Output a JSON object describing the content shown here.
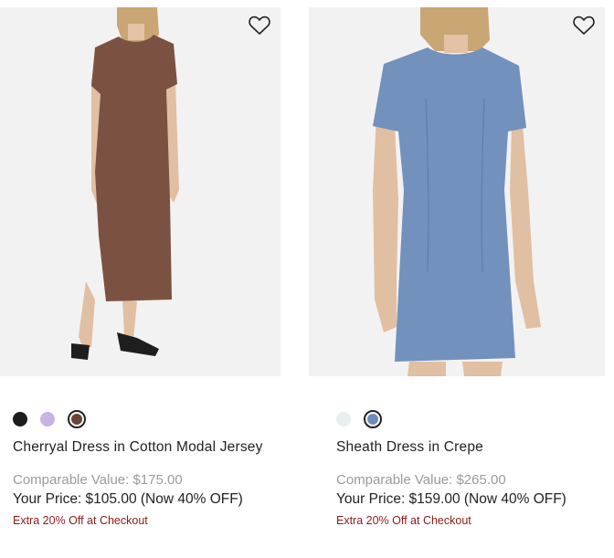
{
  "products": [
    {
      "name": "Cherryal Dress in Cotton Modal Jersey",
      "comparable_value": "Comparable Value: $175.00",
      "your_price": "Your Price: $105.00 (Now 40% OFF)",
      "extra_offer": "Extra 20% Off at Checkout",
      "colors": [
        "#1c1c1c",
        "#c9b3e2",
        "#6b4534"
      ],
      "selected_color_index": 2,
      "dress_color": "#7b5241"
    },
    {
      "name": "Sheath Dress in Crepe",
      "comparable_value": "Comparable Value: $265.00",
      "your_price": "Your Price: $159.00 (Now 40% OFF)",
      "extra_offer": "Extra 20% Off at Checkout",
      "colors": [
        "#e6eeee",
        "#6d8db8"
      ],
      "selected_color_index": 1,
      "dress_color": "#7391bd"
    }
  ],
  "icons": {
    "wishlist": "heart-outline-icon"
  }
}
